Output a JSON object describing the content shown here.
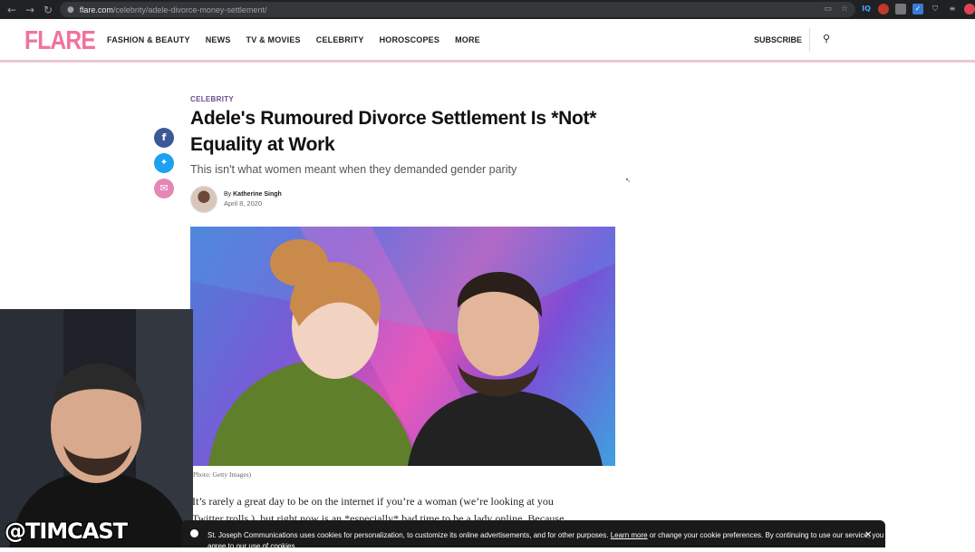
{
  "browser": {
    "back_icon": "←",
    "forward_icon": "→",
    "reload_icon": "↻",
    "lock_icon": "🔒",
    "url_domain": "flare.com",
    "url_path": "/celebrity/adele-divorce-money-settlement/",
    "extensions": [
      "IQ",
      "",
      "",
      "",
      "",
      "",
      ""
    ]
  },
  "site": {
    "logo": "FLARE",
    "nav": [
      "FASHION & BEAUTY",
      "NEWS",
      "TV & MOVIES",
      "CELEBRITY",
      "HOROSCOPES",
      "MORE"
    ],
    "subscribe": "SUBSCRIBE",
    "brand_color": "#f0739e"
  },
  "share": {
    "facebook": "f",
    "twitter": "🐦",
    "email": "✉",
    "facebook_color": "#3b5998",
    "twitter_color": "#1da1f2",
    "email_color": "#e487b6"
  },
  "article": {
    "category": "CELEBRITY",
    "headline": "Adele's Rumoured Divorce Settlement Is *Not* Equality at Work",
    "dek": "This isn't what women meant when they demanded gender parity",
    "byline_prefix": "By",
    "author": "Katherine Singh",
    "date": "April 8, 2020",
    "photo_caption": "Photo: Getty Images)",
    "body_line1": "It’s rarely a great day to be on the internet if you’re a woman (we’re looking at you",
    "body_line2": "Twitter trolls ), but right now is an *especially* bad time to be a lady online. Because"
  },
  "cookie_banner": {
    "text_before": "St. Joseph Communications uses cookies for personalization, to customize its online advertisements, and for other purposes.",
    "link": "Learn more",
    "text_after": "or change your cookie preferences. By continuing to use our service, you agree to our use of cookies.",
    "close": "✕"
  },
  "overlay": {
    "tag": "@TIMCAST"
  }
}
